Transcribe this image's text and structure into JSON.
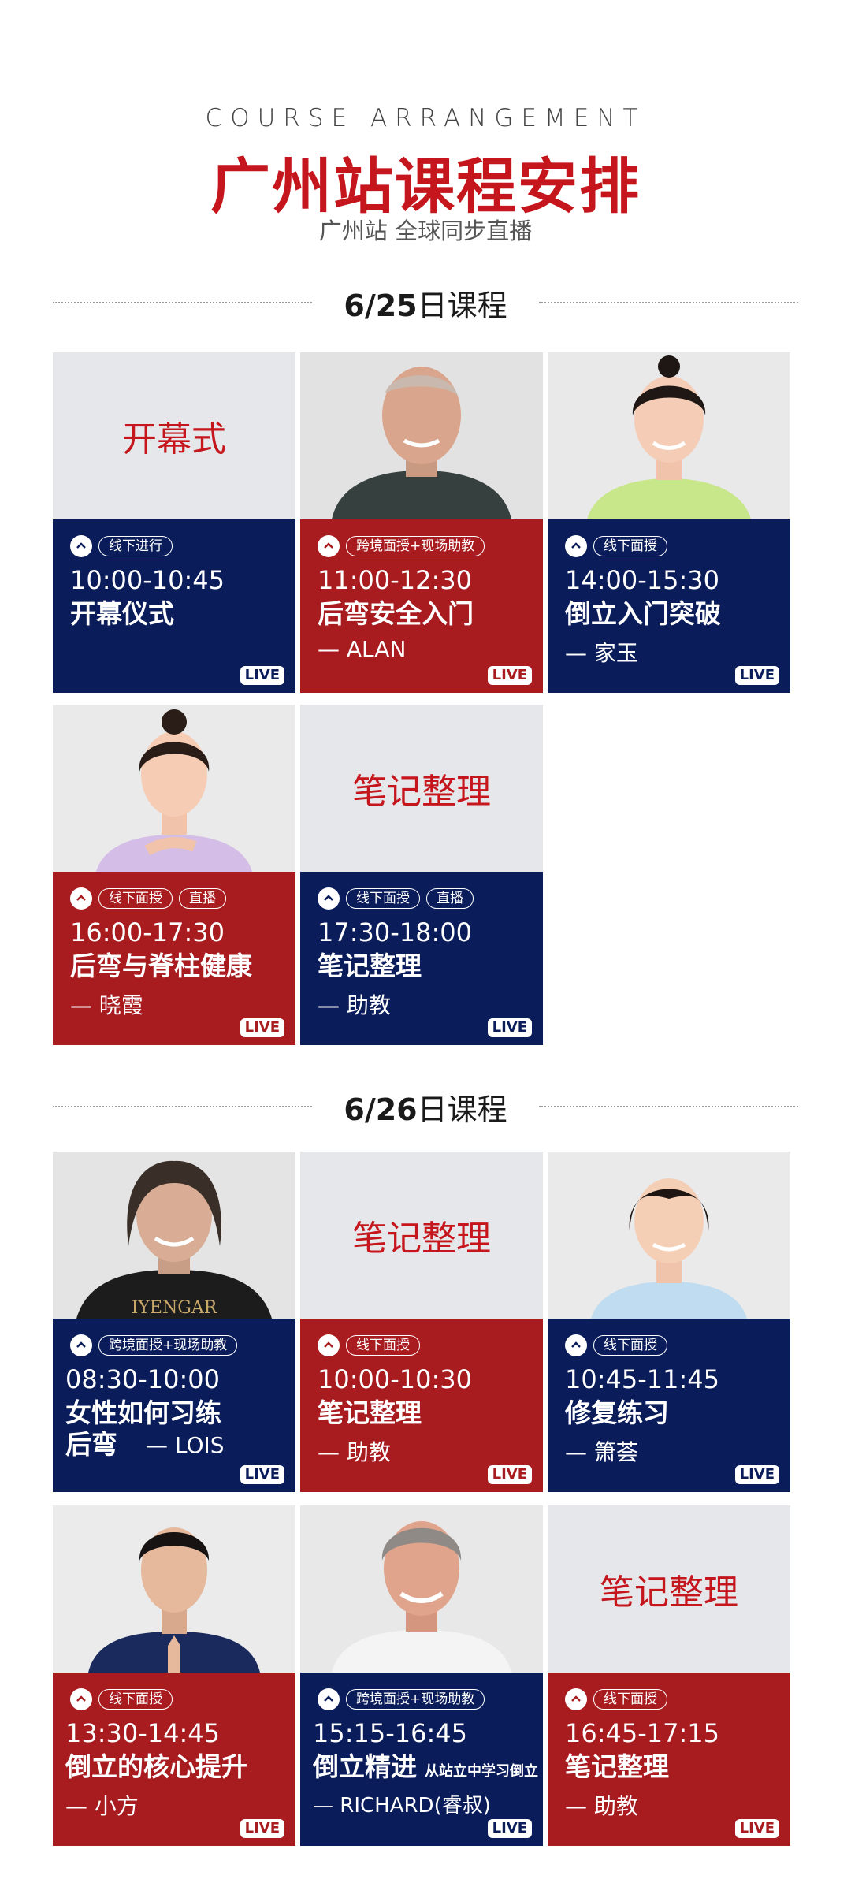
{
  "header": {
    "eyebrow": "COURSE ARRANGEMENT",
    "title": "广州站课程安排",
    "subtitle": "广州站 全球同步直播"
  },
  "days": [
    {
      "date": "6/25",
      "suffix": "日课程"
    },
    {
      "date": "6/26",
      "suffix": "日课程"
    }
  ],
  "live_label": "LIVE",
  "cards": [
    {
      "top_text": "开幕式",
      "tags": [
        "线下进行"
      ],
      "time": "10:00-10:45",
      "course": "开幕仪式",
      "course_small": "",
      "teacher": ""
    },
    {
      "top_text": "",
      "tags": [
        "跨境面授+现场助教"
      ],
      "time": "11:00-12:30",
      "course": "后弯安全入门",
      "course_small": "",
      "teacher": "— ALAN"
    },
    {
      "top_text": "",
      "tags": [
        "线下面授"
      ],
      "time": "14:00-15:30",
      "course": "倒立入门突破",
      "course_small": "",
      "teacher": "— 家玉"
    },
    {
      "top_text": "",
      "tags": [
        "线下面授",
        "直播"
      ],
      "time": "16:00-17:30",
      "course": "后弯与脊柱健康",
      "course_small": "",
      "teacher": "— 晓霞"
    },
    {
      "top_text": "笔记整理",
      "tags": [
        "线下面授",
        "直播"
      ],
      "time": "17:30-18:00",
      "course": "笔记整理",
      "course_small": "",
      "teacher": "— 助教"
    },
    {
      "top_text": "",
      "tags": [
        "跨境面授+现场助教"
      ],
      "time": "08:30-10:00",
      "course": "女性如何习练",
      "course2": "后弯",
      "course_small": "",
      "teacher": "— LOIS"
    },
    {
      "top_text": "笔记整理",
      "tags": [
        "线下面授"
      ],
      "time": "10:00-10:30",
      "course": "笔记整理",
      "course_small": "",
      "teacher": "— 助教"
    },
    {
      "top_text": "",
      "tags": [
        "线下面授"
      ],
      "time": "10:45-11:45",
      "course": "修复练习",
      "course_small": "",
      "teacher": "— 箫荟"
    },
    {
      "top_text": "",
      "tags": [
        "线下面授"
      ],
      "time": "13:30-14:45",
      "course": "倒立的核心提升",
      "course_small": "",
      "teacher": "— 小方"
    },
    {
      "top_text": "",
      "tags": [
        "跨境面授+现场助教"
      ],
      "time": "15:15-16:45",
      "course": "倒立精进",
      "course_small": "从站立中学习倒立",
      "teacher": "— RICHARD(睿叔)"
    },
    {
      "top_text": "笔记整理",
      "tags": [
        "线下面授"
      ],
      "time": "16:45-17:15",
      "course": "笔记整理",
      "course_small": "",
      "teacher": "— 助教"
    }
  ],
  "photo_text": {
    "shirt": "IYENGAR"
  },
  "colors": {
    "navy": "#0a1d5a",
    "red": "#a81c20",
    "title_red": "#c5161d"
  }
}
